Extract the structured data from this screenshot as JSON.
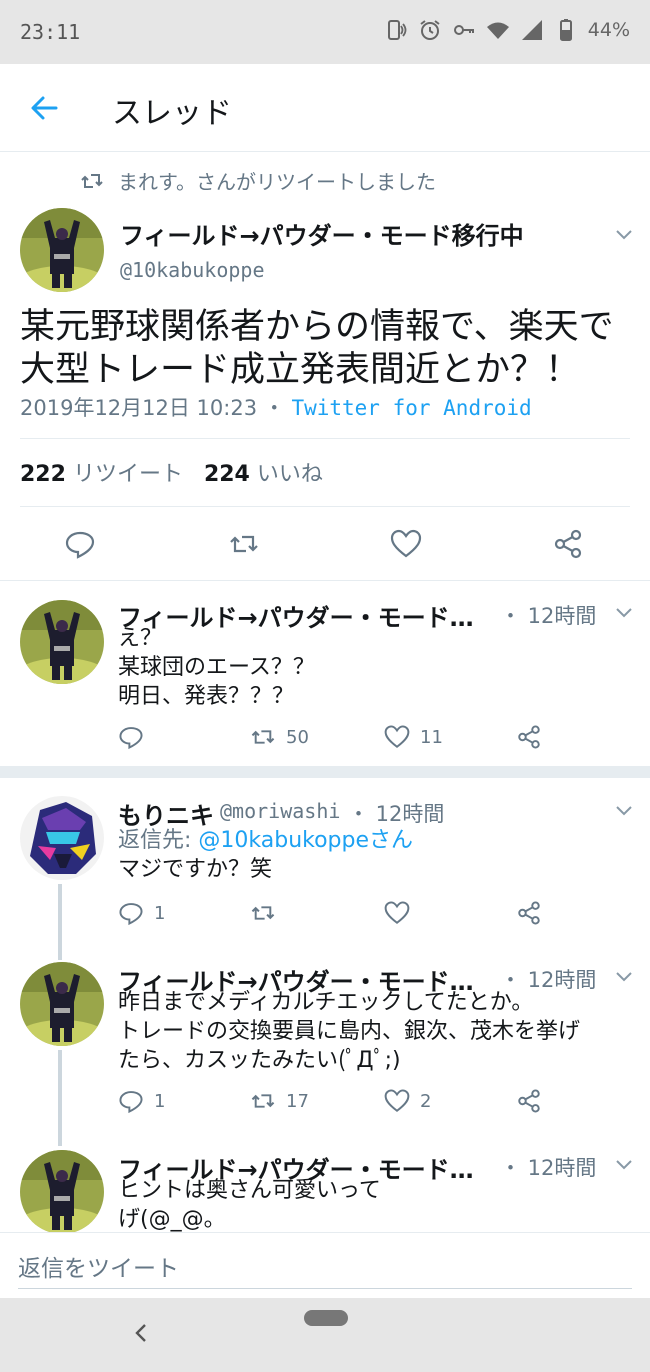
{
  "status_bar": {
    "time": "23:11",
    "battery": "44%"
  },
  "header": {
    "title": "スレッド"
  },
  "retweet_note": "まれす。さんがリツイートしました",
  "main_tweet": {
    "name": "フィールド→パウダー・モード移行中",
    "handle": "@10kabukoppe",
    "text_lines": [
      "某元野球関係者からの情報で、楽天で",
      "大型トレード成立発表間近とか？！"
    ],
    "datetime": "2019年12月12日 10:23 ・ ",
    "client": "Twitter for Android",
    "retweet_count": "222",
    "retweet_label": "リツイート",
    "like_count": "224",
    "like_label": "いいね"
  },
  "replies": [
    {
      "name": "フィールド→パウダー・モード…",
      "handle": "",
      "time": "・ 12時間",
      "reply_to": "",
      "lines": [
        "え？",
        "某球団のエース？？",
        "明日、発表？？？"
      ],
      "reply_count": "",
      "retweet_count": "50",
      "like_count": "11"
    },
    {
      "name": "もりニキ",
      "handle": "@moriwashi",
      "time": "・ 12時間",
      "reply_to_label": "返信先: ",
      "reply_to": "@10kabukoppeさん",
      "lines": [
        "マジですか？笑"
      ],
      "reply_count": "1",
      "retweet_count": "",
      "like_count": ""
    },
    {
      "name": "フィールド→パウダー・モード…",
      "handle": "",
      "time": "・ 12時間",
      "reply_to": "",
      "lines": [
        "昨日までメディカルチエックしてたとか。",
        "トレードの交換要員に島内、銀次、茂木を挙げ",
        "たら、カスッたみたい(ﾟДﾟ;)"
      ],
      "reply_count": "1",
      "retweet_count": "17",
      "like_count": "2"
    },
    {
      "name": "フィールド→パウダー・モード…",
      "handle": "",
      "time": "・ 12時間",
      "reply_to": "",
      "lines": [
        "ヒントは奥さん可愛いって",
        "げ(@_@。"
      ],
      "reply_count": "",
      "retweet_count": "",
      "like_count": ""
    }
  ],
  "reply_bar": {
    "placeholder": "返信をツイート"
  },
  "colors": {
    "accent": "#1da1f2",
    "secondary_text": "#657786",
    "divider": "#e6ecf0"
  }
}
